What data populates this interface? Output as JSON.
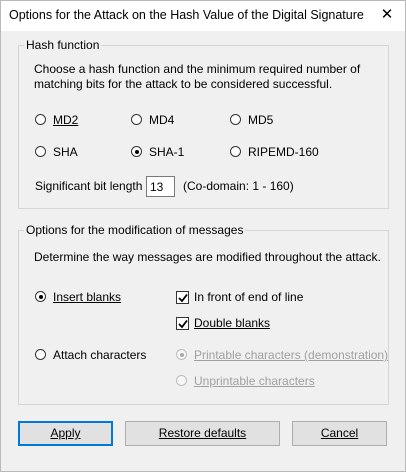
{
  "window": {
    "title": "Options for the Attack on the Hash Value of the Digital Signature",
    "close_glyph": "✕"
  },
  "hash_group": {
    "legend": "Hash function",
    "description_line1": "Choose a hash function and the minimum required number of",
    "description_line2": "matching bits for the attack to be considered successful.",
    "options": {
      "md2": {
        "label": "MD2",
        "checked": false
      },
      "md4": {
        "label": "MD4",
        "checked": false
      },
      "md5": {
        "label": "MD5",
        "checked": false
      },
      "sha": {
        "label": "SHA",
        "checked": false
      },
      "sha1": {
        "label": "SHA-1",
        "checked": true
      },
      "ripemd160": {
        "label": "RIPEMD-160",
        "checked": false
      }
    },
    "sig_bits_label": "Significant bit length",
    "sig_bits_value": "13",
    "codomain": "(Co-domain: 1 - 160)"
  },
  "mod_group": {
    "legend": "Options for the modification of messages",
    "description": "Determine the way messages are modified throughout the attack.",
    "insert_blanks": {
      "label": "Insert blanks",
      "checked": true
    },
    "in_front_of_end_of_line": {
      "label": "In front of end of line",
      "checked": true
    },
    "double_blanks": {
      "label": "Double blanks",
      "checked": true
    },
    "attach_characters": {
      "label": "Attach characters",
      "checked": false
    },
    "printable": {
      "label": "Printable characters (demonstration)",
      "checked": true,
      "disabled": true
    },
    "unprintable": {
      "label": "Unprintable characters",
      "checked": false,
      "disabled": true
    }
  },
  "buttons": {
    "apply": "Apply",
    "restore": "Restore defaults",
    "cancel": "Cancel"
  }
}
